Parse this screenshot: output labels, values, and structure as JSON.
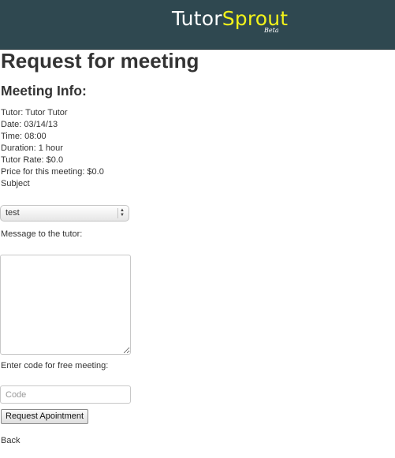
{
  "header": {
    "brand_part1": "Tutor",
    "brand_part2": "Sprout",
    "badge": "Beta"
  },
  "page": {
    "title": "Request for meeting",
    "section_title": "Meeting Info:"
  },
  "meeting_info": {
    "tutor": "Tutor: Tutor Tutor",
    "date": "Date: 03/14/13",
    "time": "Time: 08:00",
    "duration": "Duration: 1 hour",
    "rate": "Tutor Rate: $0.0",
    "price": "Price for this meeting: $0.0"
  },
  "form": {
    "subject_label": "Subject",
    "subject_value": "test",
    "message_label": "Message to the tutor:",
    "message_value": "",
    "code_label": "Enter code for free meeting:",
    "code_placeholder": "Code",
    "submit_label": "Request Apointment",
    "back_label": "Back"
  },
  "colors": {
    "header_bg": "#2f4850",
    "brand_accent": "#f2f21a"
  }
}
